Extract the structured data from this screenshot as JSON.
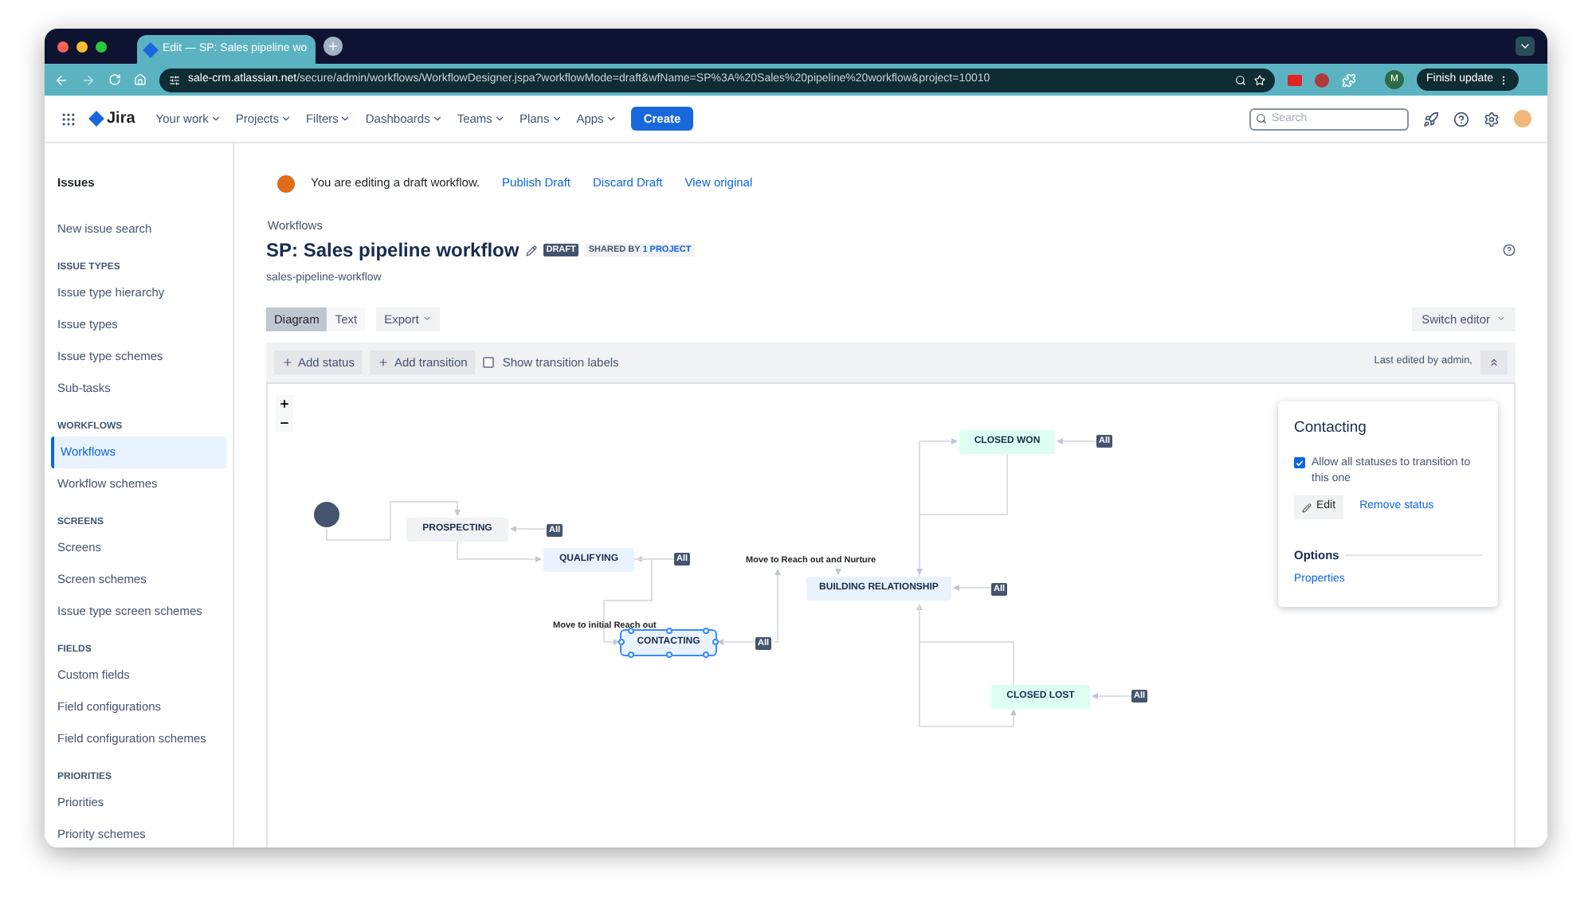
{
  "browser": {
    "tab_title": "Edit — SP: Sales pipeline wo",
    "url_host": "sale-crm.atlassian.net",
    "url_path": "/secure/admin/workflows/WorkflowDesigner.jspa?workflowMode=draft&wfName=SP%3A%20Sales%20pipeline%20workflow&project=10010",
    "profile": "M",
    "finish_update": "Finish update"
  },
  "header": {
    "product": "Jira",
    "menus": [
      "Your work",
      "Projects",
      "Filters",
      "Dashboards",
      "Teams",
      "Plans",
      "Apps"
    ],
    "create": "Create",
    "search": {
      "placeholder": "Search"
    }
  },
  "sidebar": {
    "title": "Issues",
    "sections": [
      {
        "items": [
          {
            "label": "New issue search",
            "selected": false
          }
        ]
      },
      {
        "heading": "ISSUE TYPES",
        "items": [
          {
            "label": "Issue type hierarchy",
            "selected": false
          },
          {
            "label": "Issue types",
            "selected": false
          },
          {
            "label": "Issue type schemes",
            "selected": false
          },
          {
            "label": "Sub-tasks",
            "selected": false
          }
        ]
      },
      {
        "heading": "WORKFLOWS",
        "items": [
          {
            "label": "Workflows",
            "selected": true
          },
          {
            "label": "Workflow schemes",
            "selected": false
          }
        ]
      },
      {
        "heading": "SCREENS",
        "items": [
          {
            "label": "Screens",
            "selected": false
          },
          {
            "label": "Screen schemes",
            "selected": false
          },
          {
            "label": "Issue type screen schemes",
            "selected": false
          }
        ]
      },
      {
        "heading": "FIELDS",
        "items": [
          {
            "label": "Custom fields",
            "selected": false
          },
          {
            "label": "Field configurations",
            "selected": false
          },
          {
            "label": "Field configuration schemes",
            "selected": false
          }
        ]
      },
      {
        "heading": "PRIORITIES",
        "items": [
          {
            "label": "Priorities",
            "selected": false
          },
          {
            "label": "Priority schemes",
            "selected": false
          }
        ]
      }
    ]
  },
  "banner": {
    "message": "You are editing a draft workflow.",
    "actions": [
      "Publish Draft",
      "Discard Draft",
      "View original"
    ]
  },
  "breadcrumb": "Workflows",
  "title": "SP: Sales pipeline workflow",
  "lozenge": "DRAFT",
  "shared_by": "SHARED BY",
  "shared_link": "1 PROJECT",
  "subtitle": "sales-pipeline-workflow",
  "view_tabs": [
    {
      "label": "Diagram",
      "selected": true
    },
    {
      "label": "Text",
      "selected": false
    }
  ],
  "export": "Export",
  "switch_editor": "Switch editor",
  "toolbar": {
    "add_status": "Add status",
    "add_transition": "Add transition",
    "show_labels": {
      "label": "Show transition labels",
      "checked": false
    },
    "last_edited": "Last edited by admin,"
  },
  "diagram": {
    "nodes": [
      {
        "kind": "start"
      },
      {
        "kind": "status",
        "label": "PROSPECTING",
        "color": "#f1f2f4",
        "selected": false,
        "global": "All"
      },
      {
        "kind": "status",
        "label": "QUALIFYING",
        "color": "#e9f2ff",
        "selected": false,
        "global": "All"
      },
      {
        "kind": "status",
        "label": "CONTACTING",
        "color": "#e9f2ff",
        "selected": true,
        "global": "All"
      },
      {
        "kind": "status",
        "label": "BUILDING RELATIONSHIP",
        "color": "#e9f2ff",
        "selected": false,
        "global": "All"
      },
      {
        "kind": "status",
        "label": "CLOSED WON",
        "color": "#dcfff1",
        "selected": false,
        "global": "All"
      },
      {
        "kind": "status",
        "label": "CLOSED LOST",
        "color": "#dcfff1",
        "selected": false,
        "global": "All"
      }
    ],
    "transition_labels": [
      "Move to initial Reach out",
      "Move to Reach out and Nurture"
    ]
  },
  "panel": {
    "title": "Contacting",
    "allow_all": {
      "label": "Allow all statuses to transition to this one",
      "checked": true
    },
    "edit": "Edit",
    "remove": "Remove status",
    "options_heading": "Options",
    "properties": "Properties"
  }
}
